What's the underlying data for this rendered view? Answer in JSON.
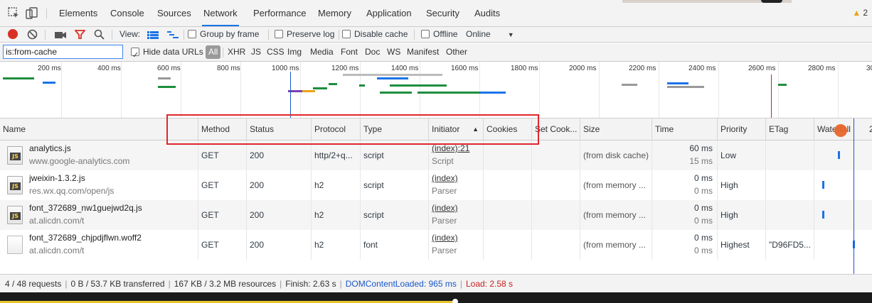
{
  "tabs": [
    "Elements",
    "Console",
    "Sources",
    "Network",
    "Performance",
    "Memory",
    "Application",
    "Security",
    "Audits"
  ],
  "active_tab": "Network",
  "warning_count": "2",
  "toolbar": {
    "view_label": "View:",
    "group_by_frame": "Group by frame",
    "preserve_log": "Preserve log",
    "disable_cache": "Disable cache",
    "offline": "Offline",
    "throttle": "Online"
  },
  "filter": {
    "value": "is:from-cache",
    "hide_data_urls": "Hide data URLs",
    "types": [
      "All",
      "XHR",
      "JS",
      "CSS",
      "Img",
      "Media",
      "Font",
      "Doc",
      "WS",
      "Manifest",
      "Other"
    ]
  },
  "overview_ticks": [
    "200 ms",
    "400 ms",
    "600 ms",
    "800 ms",
    "1000 ms",
    "1200 ms",
    "1400 ms",
    "1600 ms",
    "1800 ms",
    "2000 ms",
    "2200 ms",
    "2400 ms",
    "2600 ms",
    "2800 ms",
    "30"
  ],
  "columns": [
    "Name",
    "Method",
    "Status",
    "Protocol",
    "Type",
    "Initiator",
    "Cookies",
    "Set Cook...",
    "Size",
    "Time",
    "Priority",
    "ETag",
    "Waterfall",
    "2"
  ],
  "rows": [
    {
      "name": "analytics.js",
      "domain": "www.google-analytics.com",
      "icon": "js-file-icon",
      "method": "GET",
      "status": "200",
      "protocol": "http/2+q...",
      "type": "script",
      "initiator": "(index):21",
      "initiator_type": "Script",
      "size": "(from disk cache)",
      "time": "60 ms",
      "latency": "15 ms",
      "priority": "Low",
      "etag": ""
    },
    {
      "name": "jweixin-1.3.2.js",
      "domain": "res.wx.qq.com/open/js",
      "icon": "js-file-icon",
      "method": "GET",
      "status": "200",
      "protocol": "h2",
      "type": "script",
      "initiator": "(index)",
      "initiator_type": "Parser",
      "size": "(from memory ...",
      "time": "0 ms",
      "latency": "0 ms",
      "priority": "High",
      "etag": ""
    },
    {
      "name": "font_372689_nw1guejwd2q.js",
      "domain": "at.alicdn.com/t",
      "icon": "js-file-icon",
      "method": "GET",
      "status": "200",
      "protocol": "h2",
      "type": "script",
      "initiator": "(index)",
      "initiator_type": "Parser",
      "size": "(from memory ...",
      "time": "0 ms",
      "latency": "0 ms",
      "priority": "High",
      "etag": ""
    },
    {
      "name": "font_372689_chjpdjflwn.woff2",
      "domain": "at.alicdn.com/t",
      "icon": "font-file-icon",
      "method": "GET",
      "status": "200",
      "protocol": "h2",
      "type": "font",
      "initiator": "(index)",
      "initiator_type": "Parser",
      "size": "(from memory ...",
      "time": "0 ms",
      "latency": "0 ms",
      "priority": "Highest",
      "etag": "\"D96FD5..."
    }
  ],
  "status": {
    "requests": "4 / 48 requests",
    "transferred": "0 B / 53.7 KB transferred",
    "resources": "167 KB / 3.2 MB resources",
    "finish": "Finish: 2.63 s",
    "dom_content_loaded": "DOMContentLoaded: 965 ms",
    "load": "Load: 2.58 s"
  },
  "colors": {
    "record": "#d93025",
    "accent": "#1a73e8",
    "highlight": "#e0262b",
    "dcl": "#1a56c8",
    "load": "#c5221f"
  }
}
